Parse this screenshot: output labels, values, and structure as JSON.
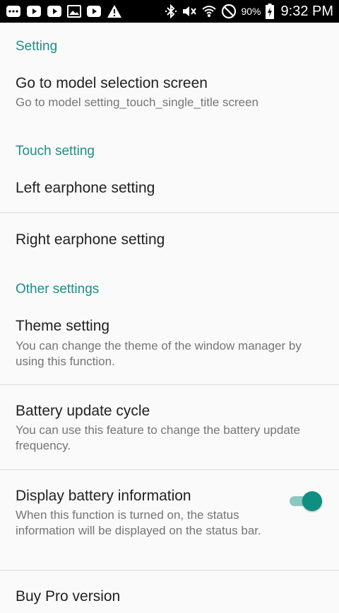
{
  "status_bar": {
    "icons_left": [
      "message-icon",
      "youtube-icon",
      "youtube-icon",
      "image-icon",
      "youtube-icon",
      "warning-icon"
    ],
    "icons_right": [
      "bluetooth-icon",
      "mute-icon",
      "wifi-icon",
      "do-not-disturb-icon",
      "battery-charging-icon"
    ],
    "battery_percent": "90%",
    "time": "9:32 PM"
  },
  "sections": {
    "setting": {
      "header": "Setting",
      "model_selection": {
        "title": "Go to model selection screen",
        "summary": "Go to model setting_touch_single_title screen"
      }
    },
    "touch": {
      "header": "Touch setting",
      "left_earphone": {
        "title": "Left earphone setting"
      },
      "right_earphone": {
        "title": "Right earphone setting"
      }
    },
    "other": {
      "header": "Other settings",
      "theme": {
        "title": "Theme setting",
        "summary": "You can change the theme of the window manager by using this function."
      },
      "battery_cycle": {
        "title": "Battery update cycle",
        "summary": "You can use this feature to change the battery update frequency."
      },
      "battery_info": {
        "title": "Display battery information",
        "summary": "When this function is turned on, the status information will be displayed on the status bar.",
        "enabled": true
      },
      "buy_pro": {
        "title": "Buy Pro version"
      }
    }
  },
  "colors": {
    "accent": "#1b8f85",
    "switch_thumb": "#0e8f80",
    "switch_track": "#8ac8c0",
    "background": "#fafafa",
    "status_bar": "#000000"
  }
}
